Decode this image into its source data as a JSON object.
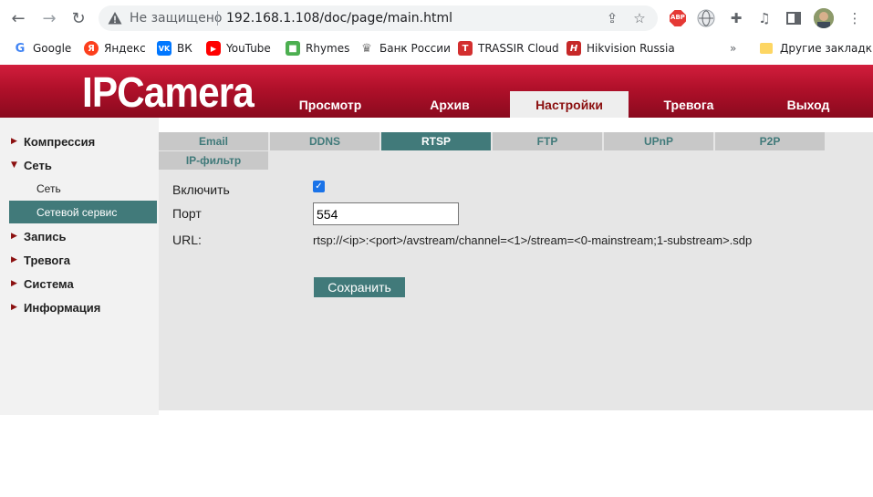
{
  "browser": {
    "status": "Не защищено",
    "url": "192.168.1.108/doc/page/main.html",
    "icons": [
      "back-arrow-icon",
      "forward-arrow-icon",
      "reload-icon",
      "warning-icon",
      "share-icon",
      "star-icon",
      "adblock-icon",
      "globe-icon",
      "puzzle-icon",
      "media-icon",
      "sidepanel-icon",
      "avatar",
      "menu-icon"
    ],
    "extensions": {
      "adblock_label": "ABP"
    }
  },
  "bookmarks": [
    {
      "label": "Google",
      "icon": "google-icon",
      "color": "#4285f4"
    },
    {
      "label": "Яндекс",
      "icon": "yandex-icon",
      "color": "#fc3f1d"
    },
    {
      "label": "ВК",
      "icon": "vk-icon",
      "color": "#0077ff"
    },
    {
      "label": "YouTube",
      "icon": "youtube-icon",
      "color": "#ff0000"
    },
    {
      "label": "Rhymes",
      "icon": "rhymes-icon",
      "color": "#4caf50"
    },
    {
      "label": "Банк России",
      "icon": "bank-icon",
      "color": "#777777"
    },
    {
      "label": "TRASSIR Cloud",
      "icon": "trassir-icon",
      "color": "#d32f2f"
    },
    {
      "label": "Hikvision Russia",
      "icon": "hikvision-icon",
      "color": "#c62828"
    }
  ],
  "bookmarks_more": "»",
  "other_bookmarks": "Другие закладки",
  "header": {
    "logo": "IPCamera",
    "nav": [
      "Просмотр",
      "Архив",
      "Настройки",
      "Тревога",
      "Выход"
    ],
    "active_nav": "Настройки"
  },
  "sidebar": {
    "items": [
      {
        "label": "Компрессия",
        "expanded": false
      },
      {
        "label": "Сеть",
        "expanded": true,
        "children": [
          "Сеть",
          "Сетевой сервис"
        ]
      },
      {
        "label": "Запись",
        "expanded": false
      },
      {
        "label": "Тревога",
        "expanded": false
      },
      {
        "label": "Система",
        "expanded": false
      },
      {
        "label": "Информация",
        "expanded": false
      }
    ],
    "active_child": "Сетевой сервис"
  },
  "tabs": [
    "Email",
    "DDNS",
    "RTSP",
    "FTP",
    "UPnP",
    "P2P",
    "IP-фильтр"
  ],
  "active_tab": "RTSP",
  "form": {
    "enable_label": "Включить",
    "enable_checked": true,
    "port_label": "Порт",
    "port_value": "554",
    "url_label": "URL:",
    "url_value": "rtsp://<ip>:<port>/avstream/channel=<1>/stream=<0-mainstream;1-substream>.sdp",
    "save_label": "Сохранить"
  },
  "colors": {
    "header_red": "#b0102a",
    "accent_teal": "#417a7a",
    "tab_inactive": "#c8c8c8",
    "content_bg": "#e6e6e6"
  }
}
